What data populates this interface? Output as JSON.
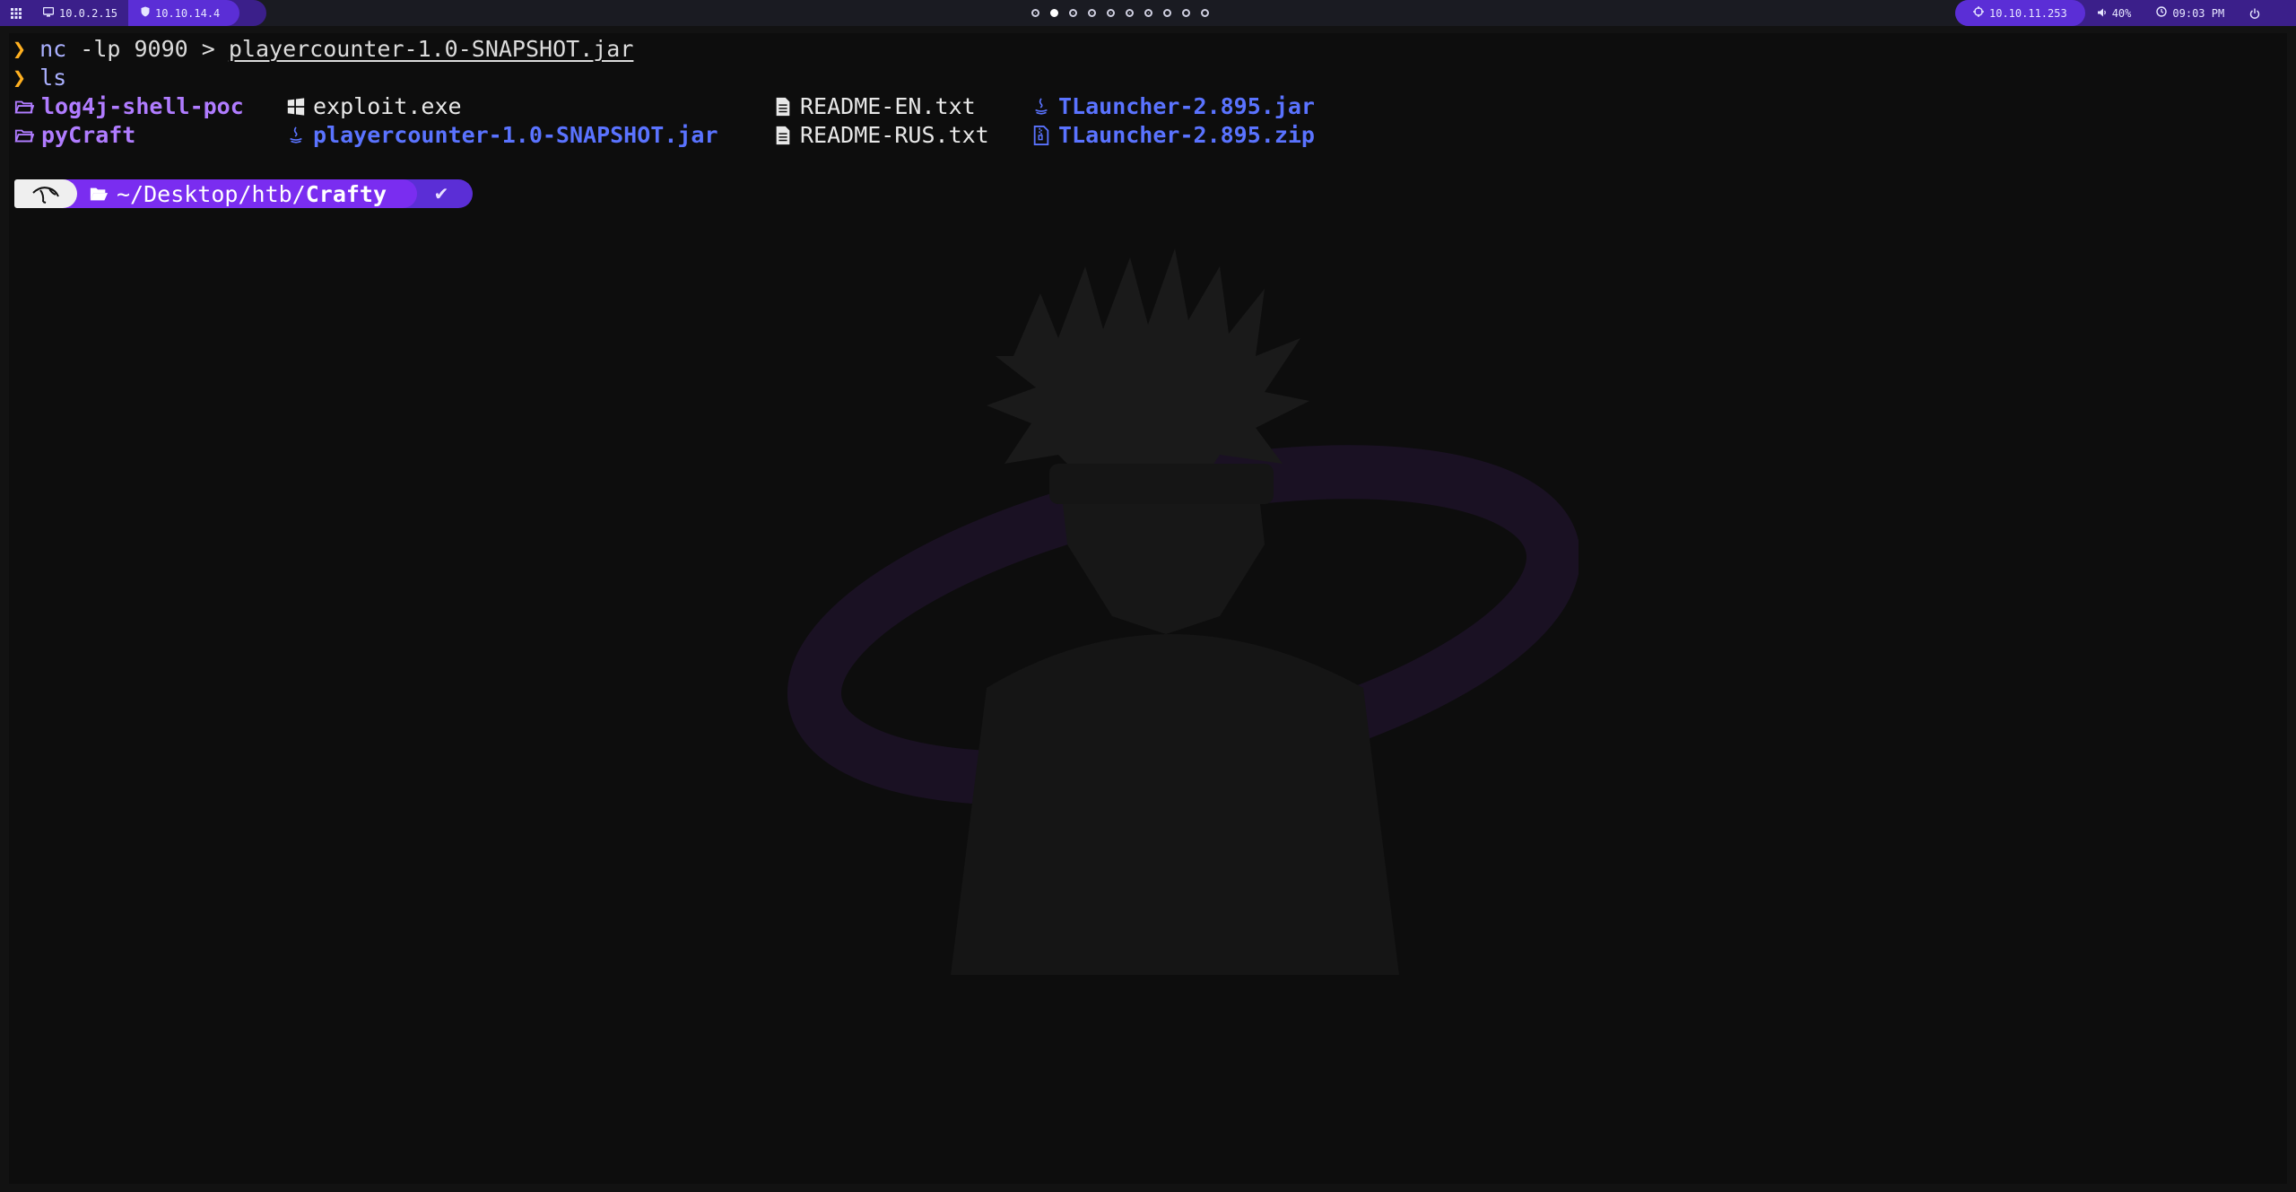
{
  "topbar": {
    "left": {
      "menu_icon": "grid-icon",
      "host_ip": "10.0.2.15",
      "vpn_ip": "10.10.14.4"
    },
    "workspaces": {
      "count": 10,
      "active_index": 1
    },
    "right": {
      "target_ip": "10.10.11.253",
      "volume": "40%",
      "time": "09:03 PM",
      "power_icon": "power-icon"
    }
  },
  "terminal": {
    "history": [
      {
        "arrow": "❯",
        "command": "nc",
        "args": " -lp 9090 > ",
        "target": "playercounter-1.0-SNAPSHOT.jar"
      },
      {
        "arrow": "❯",
        "command": "ls"
      }
    ],
    "ls_output": [
      {
        "name": "log4j-shell-poc",
        "type": "directory",
        "icon": "folder-icon"
      },
      {
        "name": "pyCraft",
        "type": "directory",
        "icon": "folder-icon"
      },
      {
        "name": "exploit.exe",
        "type": "executable",
        "icon": "windows-icon"
      },
      {
        "name": "playercounter-1.0-SNAPSHOT.jar",
        "type": "jar",
        "icon": "java-icon"
      },
      {
        "name": "README-EN.txt",
        "type": "text",
        "icon": "file-icon"
      },
      {
        "name": "README-RUS.txt",
        "type": "text",
        "icon": "file-icon"
      },
      {
        "name": "TLauncher-2.895.jar",
        "type": "jar",
        "icon": "java-icon"
      },
      {
        "name": "TLauncher-2.895.zip",
        "type": "archive",
        "icon": "zip-icon"
      }
    ],
    "prompt": {
      "os_icon": "kali-dragon-icon",
      "path_prefix": "~/Desktop/htb/",
      "path_last": "Crafty",
      "status": "✔"
    }
  },
  "colors": {
    "bar_dark": "#3b1f8a",
    "bar_light": "#5b2ed6",
    "prompt_path": "#7a2df0",
    "dir": "#b07cff",
    "jar": "#5a73ff",
    "arrow": "#ffb020"
  }
}
